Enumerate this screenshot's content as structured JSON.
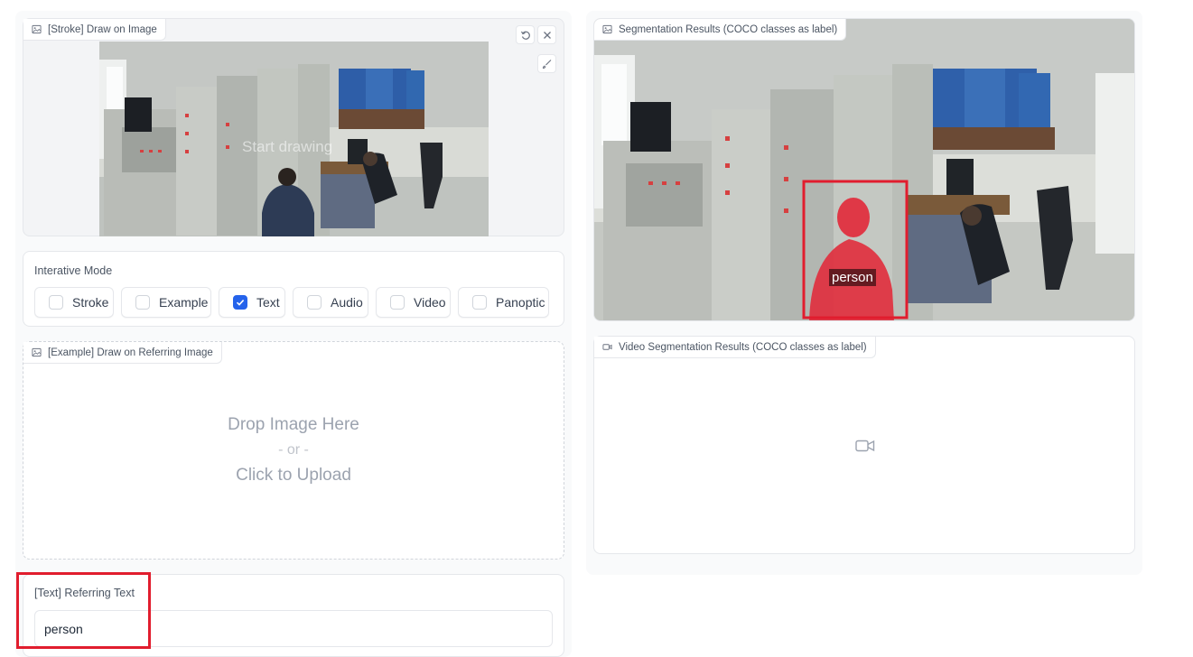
{
  "colors": {
    "accent": "#2563eb",
    "highlight_red": "#e11d2e",
    "mask_red": "#e0303f"
  },
  "stroke_panel": {
    "label": "[Stroke] Draw on Image",
    "overlay_text": "Start drawing",
    "buttons": {
      "undo": "undo-icon",
      "clear": "close-icon",
      "brush": "brush-icon"
    }
  },
  "mode": {
    "title": "Interative Mode",
    "options": [
      {
        "label": "Stroke",
        "checked": false
      },
      {
        "label": "Example",
        "checked": false
      },
      {
        "label": "Text",
        "checked": true
      },
      {
        "label": "Audio",
        "checked": false
      },
      {
        "label": "Video",
        "checked": false
      },
      {
        "label": "Panoptic",
        "checked": false
      }
    ]
  },
  "example_panel": {
    "label": "[Example] Draw on Referring Image",
    "drop_line1": "Drop Image Here",
    "drop_or": "- or -",
    "drop_line2": "Click to Upload"
  },
  "text_panel": {
    "label": "[Text] Referring Text",
    "value": "person"
  },
  "seg_panel": {
    "label": "Segmentation Results (COCO classes as label)",
    "detection_label": "person"
  },
  "video_panel": {
    "label": "Video Segmentation Results (COCO classes as label)",
    "placeholder_icon": "video-camera-icon"
  }
}
